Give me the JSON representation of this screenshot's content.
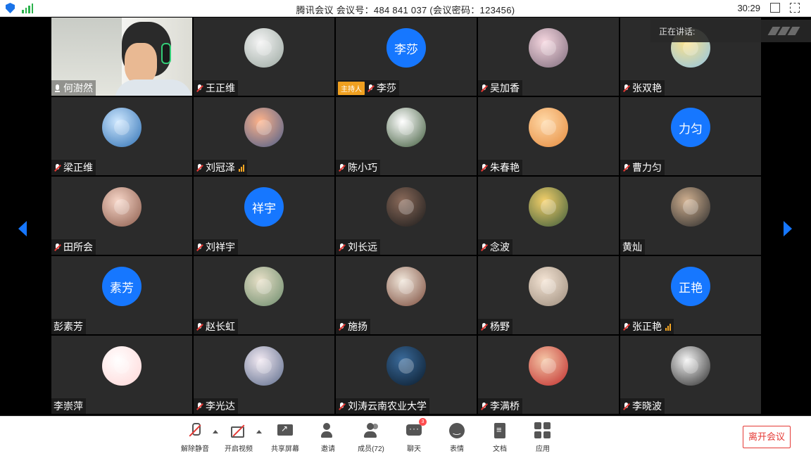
{
  "titlebar": {
    "title": "腾讯会议  会议号：484 841 037  (会议密码：123456)",
    "timer": "30:29"
  },
  "speaking": {
    "label": "正在讲话:"
  },
  "participants": [
    {
      "name": "何澍然",
      "type": "video",
      "mic": "on"
    },
    {
      "name": "王正维",
      "type": "image",
      "mic": "muted",
      "c1": "#f4f4f4",
      "c2": "#9aa7a0",
      "avatar_icon": "cartoon-doll-avatar"
    },
    {
      "name": "李莎",
      "type": "text",
      "avatar_text": "李莎",
      "mic": "muted",
      "host": "主持人"
    },
    {
      "name": "吴加香",
      "type": "image",
      "mic": "muted",
      "c1": "#f6d7e0",
      "c2": "#7d6a7a",
      "avatar_icon": "cartoon-bunny-avatar"
    },
    {
      "name": "张双艳",
      "type": "image",
      "mic": "muted",
      "c1": "#ffe38a",
      "c2": "#8fc4e6",
      "avatar_icon": "cartoon-girl-avatar"
    },
    {
      "name": "梁正维",
      "type": "image",
      "mic": "muted",
      "c1": "#cfe8ff",
      "c2": "#2d6fb3",
      "avatar_icon": "silhouette-desk-avatar"
    },
    {
      "name": "刘冠泽",
      "type": "image",
      "mic": "muted",
      "c1": "#ffb38a",
      "c2": "#4a5d8a",
      "avatar_icon": "sunset-sea-avatar",
      "signal": true
    },
    {
      "name": "陈小巧",
      "type": "image",
      "mic": "muted",
      "c1": "#ffffff",
      "c2": "#3e5a3a",
      "avatar_icon": "white-bird-avatar"
    },
    {
      "name": "朱春艳",
      "type": "image",
      "mic": "muted",
      "c1": "#ffd9a8",
      "c2": "#e58a3c",
      "avatar_icon": "cartoon-headphones-avatar"
    },
    {
      "name": "曹力匀",
      "type": "text",
      "avatar_text": "力匀",
      "mic": "muted"
    },
    {
      "name": "田所会",
      "type": "image",
      "mic": "muted",
      "c1": "#f7d6c8",
      "c2": "#8a5a4a",
      "avatar_icon": "anime-girl-avatar"
    },
    {
      "name": "刘祥宇",
      "type": "text",
      "avatar_text": "祥宇",
      "mic": "muted"
    },
    {
      "name": "刘长远",
      "type": "image",
      "mic": "muted",
      "c1": "#8a6a5a",
      "c2": "#1a1a1a",
      "avatar_icon": "piano-dark-avatar"
    },
    {
      "name": "念波",
      "type": "image",
      "mic": "muted",
      "c1": "#f4d06a",
      "c2": "#3a5a3a",
      "avatar_icon": "cat-figure-avatar"
    },
    {
      "name": "黄灿",
      "type": "image",
      "mic": "none",
      "c1": "#d0b090",
      "c2": "#2a2a2a",
      "avatar_icon": "man-sunglasses-avatar"
    },
    {
      "name": "彭素芳",
      "type": "text",
      "avatar_text": "素芳",
      "mic": "none"
    },
    {
      "name": "赵长虹",
      "type": "image",
      "mic": "muted",
      "c1": "#e8e0c8",
      "c2": "#6a8a6a",
      "avatar_icon": "flower-field-avatar"
    },
    {
      "name": "施扬",
      "type": "image",
      "mic": "muted",
      "c1": "#f0e6da",
      "c2": "#7a4a3a",
      "avatar_icon": "anime-character-avatar"
    },
    {
      "name": "杨野",
      "type": "image",
      "mic": "muted",
      "c1": "#f4e4d4",
      "c2": "#9a8a7a",
      "avatar_icon": "shiba-dog-avatar"
    },
    {
      "name": "张正艳",
      "type": "text",
      "avatar_text": "正艳",
      "mic": "muted",
      "signal": true
    },
    {
      "name": "李崇萍",
      "type": "image",
      "mic": "none",
      "c1": "#ffffff",
      "c2": "#ffd6d6",
      "avatar_icon": "red-pig-avatar"
    },
    {
      "name": "李光达",
      "type": "image",
      "mic": "muted",
      "c1": "#f2e9f2",
      "c2": "#5a6a8a",
      "avatar_icon": "cartoon-cat-avatar"
    },
    {
      "name": "刘涛云南农业大学",
      "type": "image",
      "mic": "muted",
      "c1": "#3a6a9a",
      "c2": "#0a1a2a",
      "avatar_icon": "boy-night-avatar"
    },
    {
      "name": "李满桥",
      "type": "image",
      "mic": "muted",
      "c1": "#f4c6a6",
      "c2": "#c02a2a",
      "avatar_icon": "cartoon-boy-red-avatar"
    },
    {
      "name": "李晓波",
      "type": "image",
      "mic": "muted",
      "c1": "#f4f4f4",
      "c2": "#2a2a2a",
      "avatar_icon": "man-portrait-avatar"
    }
  ],
  "toolbar": {
    "items": [
      {
        "label": "解除静音",
        "icon": "microphone-muted-icon",
        "caret": true
      },
      {
        "label": "开启视频",
        "icon": "camera-off-icon",
        "caret": true
      },
      {
        "label": "共享屏幕",
        "icon": "share-screen-icon"
      },
      {
        "label": "邀请",
        "icon": "invite-icon"
      },
      {
        "label": "成员(72)",
        "icon": "members-icon"
      },
      {
        "label": "聊天",
        "icon": "chat-icon",
        "badge": "3"
      },
      {
        "label": "表情",
        "icon": "emoji-icon"
      },
      {
        "label": "文档",
        "icon": "document-icon"
      },
      {
        "label": "应用",
        "icon": "apps-icon"
      }
    ],
    "leave_label": "离开会议"
  },
  "colors": {
    "accent": "#1677ff",
    "danger": "#e53935",
    "tile_bg": "#2b2b2b",
    "host_badge": "#f0a020"
  }
}
